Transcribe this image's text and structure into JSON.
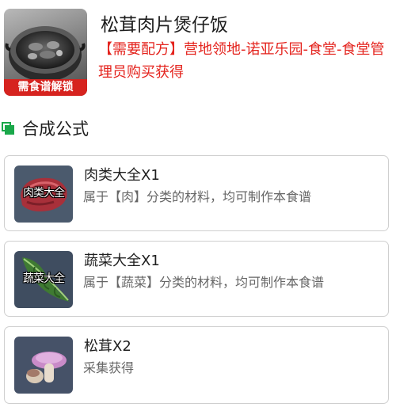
{
  "recipe": {
    "title": "松茸肉片煲仔饭",
    "lock_badge": "需食谱解锁",
    "unlock_note": "【需要配方】营地领地-诺亚乐园-食堂-食堂管理员购买获得"
  },
  "section": {
    "title": "合成公式"
  },
  "ingredients": [
    {
      "icon": "meat-icon",
      "thumb_label": "肉类大全",
      "name": "肉类大全X1",
      "desc": "属于【肉】分类的材料，均可制作本食谱"
    },
    {
      "icon": "vegetable-icon",
      "thumb_label": "蔬菜大全",
      "name": "蔬菜大全X1",
      "desc": "属于【蔬菜】分类的材料，均可制作本食谱"
    },
    {
      "icon": "matsutake-icon",
      "thumb_label": "",
      "name": "松茸X2",
      "desc": "采集获得"
    }
  ],
  "colors": {
    "accent_red": "#e4231d",
    "badge_red": "#d6231f",
    "section_green": "#1aa84a"
  }
}
